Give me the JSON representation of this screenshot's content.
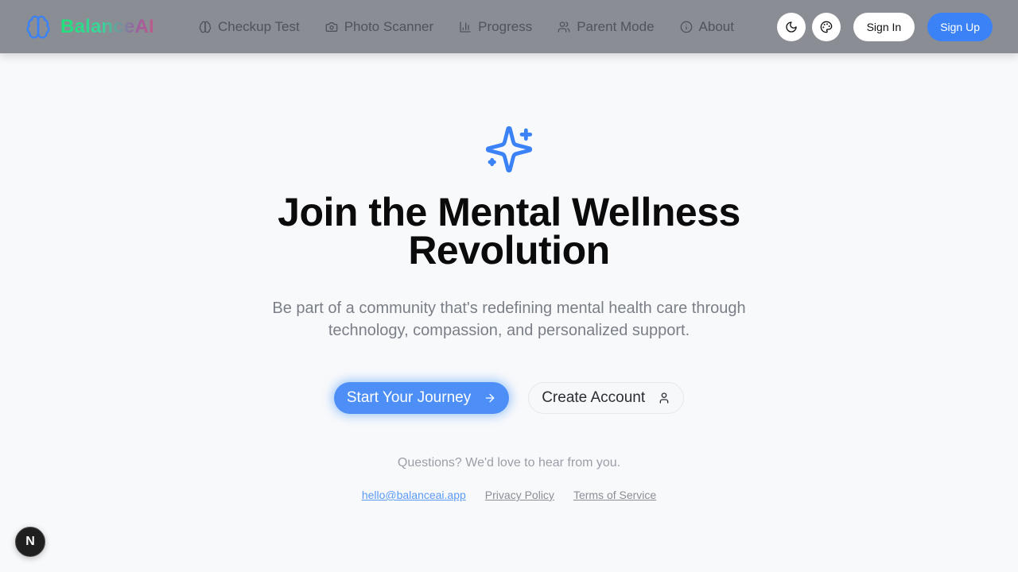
{
  "header": {
    "brand": "BalanceAI",
    "brand_icon": "brain-icon",
    "nav": [
      {
        "label": "Checkup Test",
        "icon": "brain-icon"
      },
      {
        "label": "Photo Scanner",
        "icon": "camera-icon"
      },
      {
        "label": "Progress",
        "icon": "bar-chart-icon"
      },
      {
        "label": "Parent Mode",
        "icon": "users-icon"
      },
      {
        "label": "About",
        "icon": "info-icon"
      }
    ],
    "theme_toggle_icon": "moon-icon",
    "palette_icon": "palette-icon",
    "sign_in": "Sign In",
    "sign_up": "Sign Up"
  },
  "hero": {
    "icon": "sparkles-icon",
    "title_line1": "Join the Mental Wellness",
    "title_line2": "Revolution",
    "subtitle": "Be part of a community that's redefining mental health care through technology, compassion, and personalized support.",
    "primary_cta": "Start Your Journey",
    "secondary_cta": "Create Account"
  },
  "contact": {
    "prompt": "Questions? We'd love to hear from you.",
    "email": "hello@balanceai.app",
    "privacy": "Privacy Policy",
    "terms": "Terms of Service"
  },
  "dev_badge": "N",
  "colors": {
    "accent": "#3b82f6",
    "navbar_bg": "#8a8d94",
    "page_bg": "#f8f9fb"
  }
}
